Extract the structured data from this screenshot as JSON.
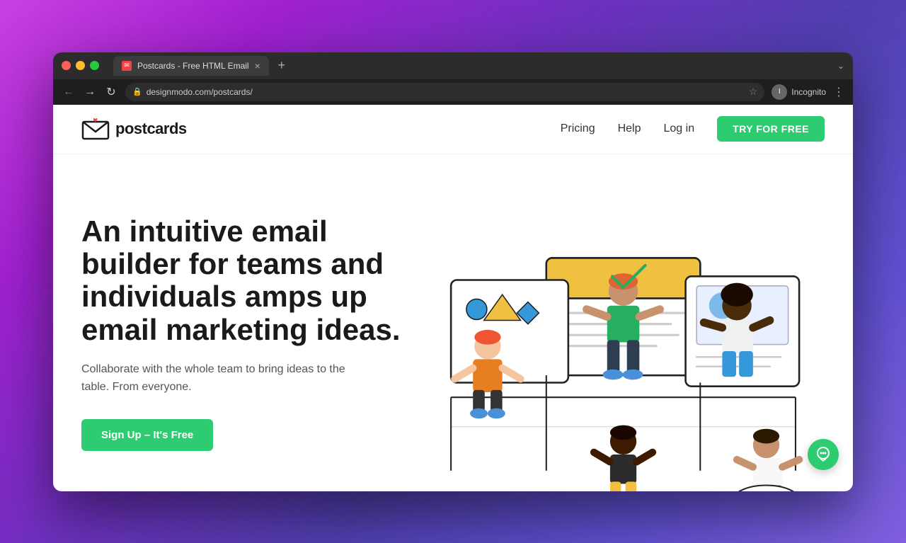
{
  "browser": {
    "traffic_lights": [
      "close",
      "minimize",
      "maximize"
    ],
    "tab": {
      "title": "Postcards - Free HTML Email",
      "favicon_text": "✉",
      "close_symbol": "×"
    },
    "new_tab_symbol": "+",
    "chevron_symbol": "⌄",
    "nav": {
      "back_symbol": "←",
      "forward_symbol": "→",
      "refresh_symbol": "↻",
      "lock_symbol": "🔒",
      "url": "designmodo.com/postcards/",
      "star_symbol": "☆"
    },
    "profile": {
      "name": "Incognito",
      "initials": "I"
    },
    "menu_symbol": "⋮"
  },
  "site": {
    "logo_text": "postcards",
    "nav": {
      "pricing": "Pricing",
      "help": "Help",
      "login": "Log in",
      "cta": "TRY FOR FREE"
    },
    "hero": {
      "headline": "An intuitive email builder for teams and individuals amps up email marketing ideas.",
      "subtext": "Collaborate with the whole team to bring ideas to the table. From everyone.",
      "cta_label": "Sign Up – It's Free"
    }
  },
  "chat_widget": {
    "symbol": "💬"
  }
}
